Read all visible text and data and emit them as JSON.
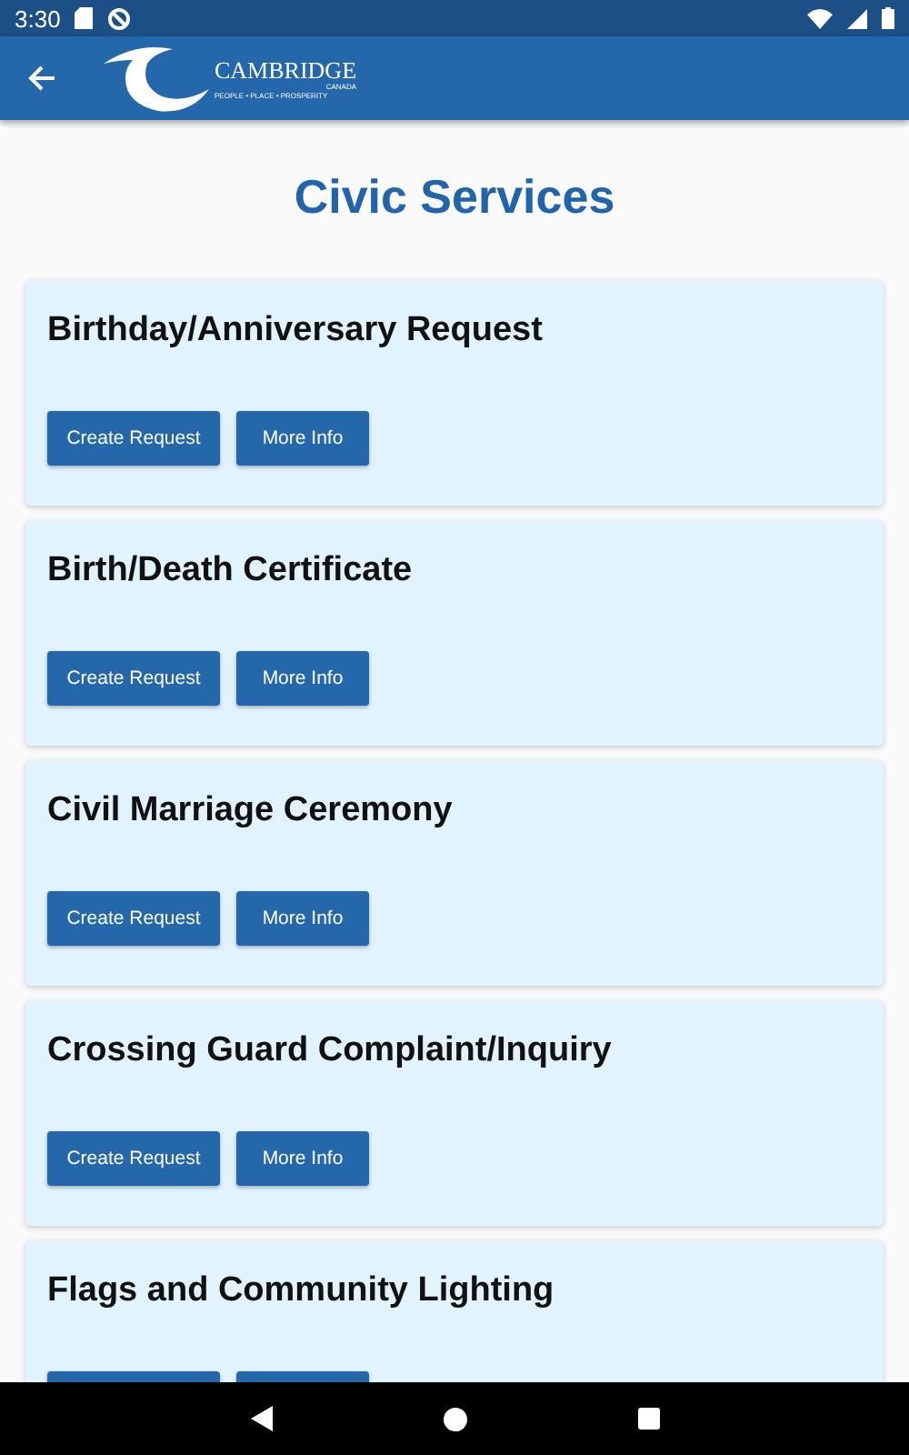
{
  "status_bar": {
    "time": "3:30"
  },
  "app_bar": {
    "logo": {
      "name": "CAMBRIDGE",
      "country": "CANADA",
      "tagline": "PEOPLE • PLACE • PROSPERITY"
    }
  },
  "page_title": "Civic Services",
  "services": [
    {
      "title": "Birthday/Anniversary Request",
      "buttons": [
        "Create Request",
        "More Info"
      ]
    },
    {
      "title": "Birth/Death Certificate",
      "buttons": [
        "Create Request",
        "More Info"
      ]
    },
    {
      "title": "Civil Marriage Ceremony",
      "buttons": [
        "Create Request",
        "More Info"
      ]
    },
    {
      "title": "Crossing Guard Complaint/Inquiry",
      "buttons": [
        "Create Request",
        "More Info"
      ]
    },
    {
      "title": "Flags and Community Lighting",
      "buttons_cut_off": true
    }
  ]
}
